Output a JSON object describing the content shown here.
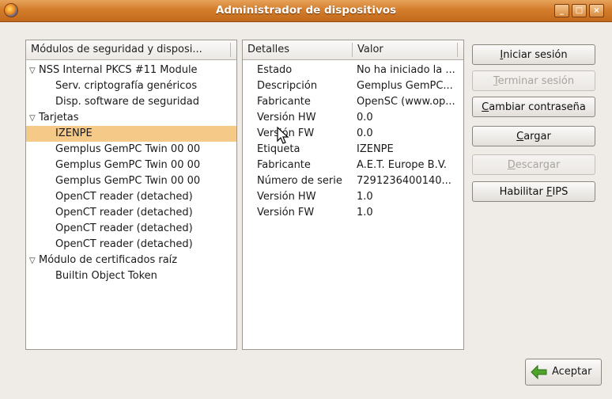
{
  "window": {
    "title": "Administrador de dispositivos"
  },
  "tree": {
    "header": "Módulos de seguridad y disposi...",
    "items": [
      {
        "label": "NSS Internal PKCS #11 Module",
        "level": 0,
        "expander": "▽"
      },
      {
        "label": "Serv. criptografía genéricos",
        "level": 1
      },
      {
        "label": "Disp. software de seguridad",
        "level": 1
      },
      {
        "label": "Tarjetas",
        "level": 0,
        "expander": "▽"
      },
      {
        "label": "IZENPE",
        "level": 1,
        "selected": true
      },
      {
        "label": "Gemplus GemPC Twin 00 00",
        "level": 1
      },
      {
        "label": "Gemplus GemPC Twin 00 00",
        "level": 1
      },
      {
        "label": "Gemplus GemPC Twin 00 00",
        "level": 1
      },
      {
        "label": "OpenCT reader (detached)",
        "level": 1
      },
      {
        "label": "OpenCT reader (detached)",
        "level": 1
      },
      {
        "label": "OpenCT reader (detached)",
        "level": 1
      },
      {
        "label": "OpenCT reader (detached)",
        "level": 1
      },
      {
        "label": "Módulo de certificados raíz",
        "level": 0,
        "expander": "▽"
      },
      {
        "label": "Builtin Object Token",
        "level": 1
      }
    ]
  },
  "details": {
    "col_key": "Detalles",
    "col_value": "Valor",
    "rows": [
      {
        "k": "Estado",
        "v": "No ha iniciado la ..."
      },
      {
        "k": "Descripción",
        "v": "Gemplus GemPC..."
      },
      {
        "k": "Fabricante",
        "v": "OpenSC (www.op..."
      },
      {
        "k": "Versión HW",
        "v": "0.0"
      },
      {
        "k": "Versión FW",
        "v": "0.0"
      },
      {
        "k": "Etiqueta",
        "v": "IZENPE"
      },
      {
        "k": "Fabricante",
        "v": "A.E.T. Europe B.V."
      },
      {
        "k": "Número de serie",
        "v": "7291236400140..."
      },
      {
        "k": "Versión HW",
        "v": "1.0"
      },
      {
        "k": "Versión FW",
        "v": "1.0"
      }
    ]
  },
  "buttons": {
    "login": {
      "accel": "I",
      "rest": "niciar sesión"
    },
    "logout": {
      "accel": "T",
      "rest": "erminar sesión"
    },
    "change_password": {
      "accel": "C",
      "rest": "ambiar contraseña"
    },
    "load": {
      "accel": "C",
      "rest": "argar"
    },
    "unload": {
      "accel": "D",
      "rest": "escargar"
    },
    "fips": {
      "pre": "Habilitar ",
      "accel": "F",
      "rest": "IPS"
    },
    "ok": "Aceptar"
  },
  "colors": {
    "titlebar": "#d47d2c",
    "selection": "#f5c987",
    "ok_icon": "#4ea52a"
  }
}
